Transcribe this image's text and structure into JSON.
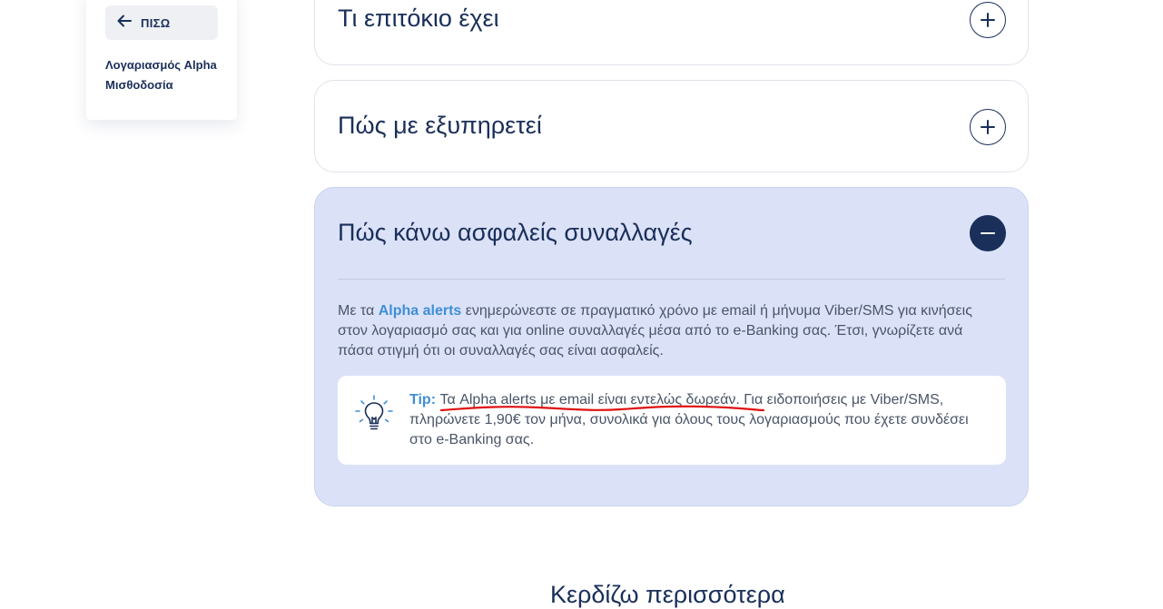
{
  "sidebar": {
    "back_label": "ΠΙΣΩ",
    "title": "Λογαριασμός Alpha Μισθοδοσία"
  },
  "accordion": [
    {
      "title": "Τι επιτόκιο έχει",
      "state": "collapsed"
    },
    {
      "title": "Πώς με εξυπηρετεί",
      "state": "collapsed"
    },
    {
      "title": "Πώς κάνω ασφαλείς συναλλαγές",
      "state": "expanded"
    }
  ],
  "expanded": {
    "text_before": "Με τα ",
    "highlight": "Alpha alerts",
    "text_after": " ενημερώνεστε σε πραγματικό χρόνο με email ή μήνυμα Viber/SMS για κινήσεις στον λογαριασμό σας και για online συναλλαγές μέσα από το e-Banking σας. Έτσι, γνωρίζετε ανά πάσα στιγμή ότι οι συναλλαγές σας είναι ασφαλείς.",
    "tip_label": "Tip:",
    "tip_text": " Τα Alpha alerts με email είναι εντελώς δωρεάν. Για ειδοποιήσεις με Viber/SMS, πληρώνετε 1,90€ τον μήνα, συνολικά για όλους τους λογαριασμούς που έχετε συνδέσει στο e-Banking σας."
  },
  "section_heading": "Κερδίζω περισσότερα",
  "icons": {
    "back": "arrow-left-icon",
    "expand": "plus-icon",
    "collapse": "minus-icon",
    "tip": "lightbulb-icon"
  },
  "colors": {
    "navy": "#1a2f5a",
    "accent_blue": "#3f8fd6",
    "expanded_bg": "#dbe2f8",
    "annotation_red": "#e01010"
  }
}
